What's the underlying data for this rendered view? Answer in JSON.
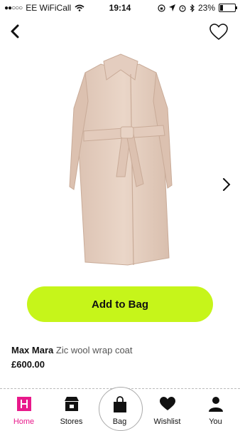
{
  "status_bar": {
    "carrier": "EE WiFiCall",
    "time": "19:14",
    "battery": "23%",
    "battery_level": 0.23
  },
  "product": {
    "brand": "Max Mara",
    "name": "Zic wool wrap coat",
    "price": "£600.00",
    "image_icon": "coat-image"
  },
  "actions": {
    "add_to_bag_label": "Add to Bag"
  },
  "tabs": [
    {
      "label": "Home",
      "icon": "home-icon",
      "active": true
    },
    {
      "label": "Stores",
      "icon": "store-icon",
      "active": false
    },
    {
      "label": "Bag",
      "icon": "bag-icon",
      "active": false
    },
    {
      "label": "Wishlist",
      "icon": "heart-icon",
      "active": false
    },
    {
      "label": "You",
      "icon": "person-icon",
      "active": false
    }
  ],
  "colors": {
    "accent": "#c6f51a",
    "home_pink": "#e8198b"
  }
}
